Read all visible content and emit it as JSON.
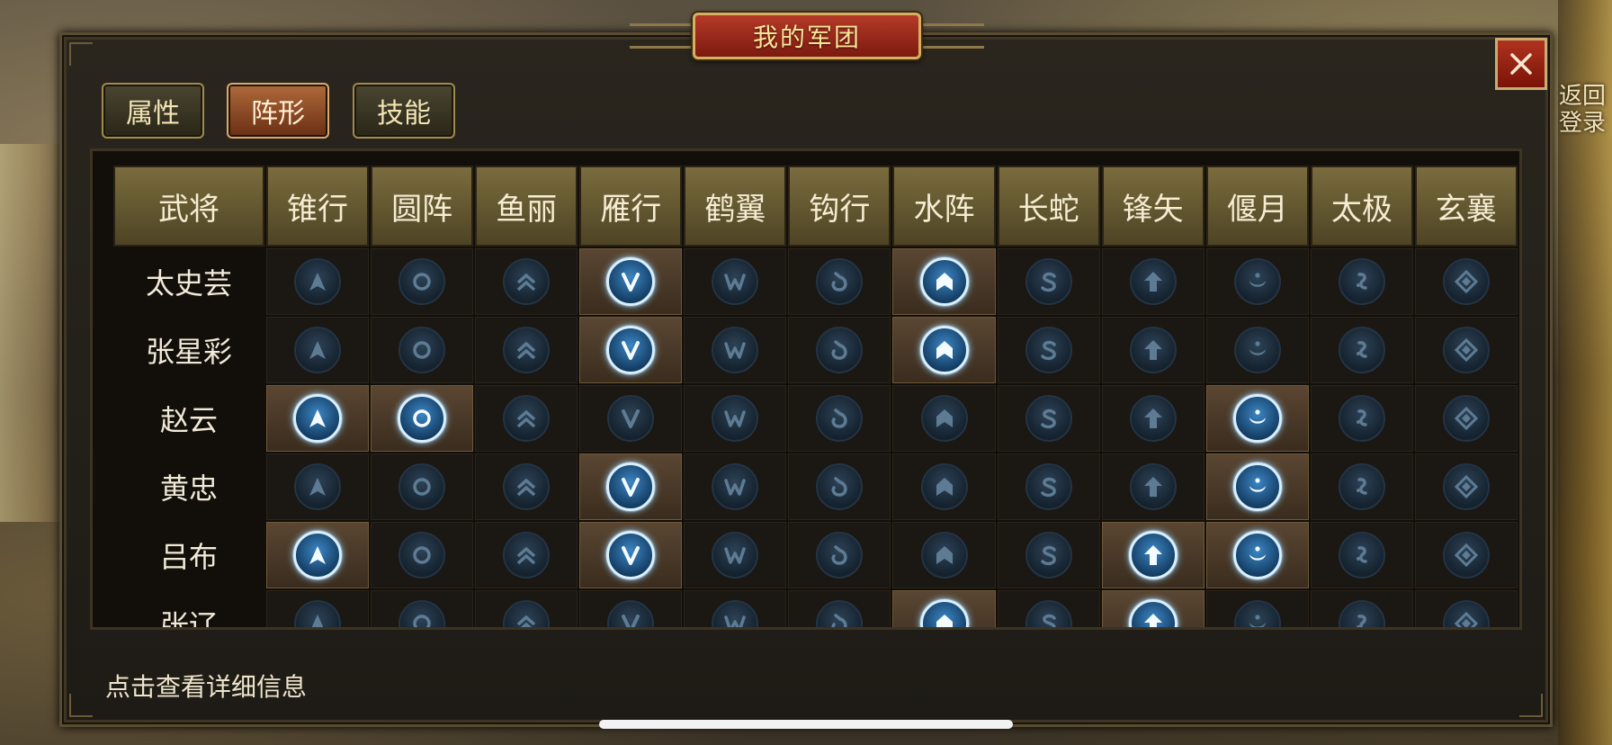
{
  "background": {
    "return_label": "返回登录"
  },
  "dialog": {
    "title": "我的军团",
    "close_icon": "close-icon"
  },
  "tabs": [
    {
      "label": "属性",
      "active": false
    },
    {
      "label": "阵形",
      "active": true
    },
    {
      "label": "技能",
      "active": false
    }
  ],
  "table": {
    "name_header": "武将",
    "formations": [
      {
        "label": "锥行",
        "icon": "arrow-up-icon"
      },
      {
        "label": "圆阵",
        "icon": "circle-icon"
      },
      {
        "label": "鱼丽",
        "icon": "double-chevron-icon"
      },
      {
        "label": "雁行",
        "icon": "v-icon"
      },
      {
        "label": "鹤翼",
        "icon": "w-icon"
      },
      {
        "label": "钩行",
        "icon": "hook-icon"
      },
      {
        "label": "水阵",
        "icon": "house-icon"
      },
      {
        "label": "长蛇",
        "icon": "s-icon"
      },
      {
        "label": "锋矢",
        "icon": "arrow-icon"
      },
      {
        "label": "偃月",
        "icon": "crescent-icon"
      },
      {
        "label": "太极",
        "icon": "taiji-icon"
      },
      {
        "label": "玄襄",
        "icon": "diamond-icon"
      }
    ],
    "generals": [
      {
        "name": "太史芸",
        "active": [
          3,
          6
        ]
      },
      {
        "name": "张星彩",
        "active": [
          3,
          6
        ]
      },
      {
        "name": "赵云",
        "active": [
          0,
          1,
          9
        ]
      },
      {
        "name": "黄忠",
        "active": [
          3,
          9
        ]
      },
      {
        "name": "吕布",
        "active": [
          0,
          3,
          8,
          9
        ]
      },
      {
        "name": "张辽",
        "active": [
          6,
          8
        ]
      }
    ]
  },
  "hint_text": "点击查看详细信息",
  "colors": {
    "active_icon": "#3c86c4",
    "inactive_icon": "#15222e",
    "title_plate": "#b53a28",
    "header_gold": "#7a6c3e"
  }
}
